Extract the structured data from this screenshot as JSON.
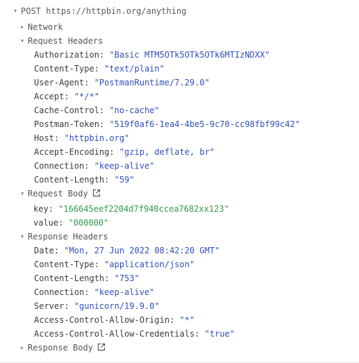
{
  "request": {
    "method": "POST",
    "url": "https://httpbin.org/anything"
  },
  "sections": {
    "network": "Network",
    "request_headers": "Request Headers",
    "request_body": "Request Body",
    "response_headers": "Response Headers",
    "response_body": "Response Body"
  },
  "request_headers": [
    {
      "key": "Authorization",
      "value": "\"Basic MTM5OTk5OTk5OTk6MTIzNDXX\""
    },
    {
      "key": "Content-Type",
      "value": "\"text/plain\""
    },
    {
      "key": "User-Agent",
      "value": "\"PostmanRuntime/7.29.0\""
    },
    {
      "key": "Accept",
      "value": "\"*/*\""
    },
    {
      "key": "Cache-Control",
      "value": "\"no-cache\""
    },
    {
      "key": "Postman-Token",
      "value": "\"519f0af6-1ea4-4be5-9c70-cc98fbf99c42\""
    },
    {
      "key": "Host",
      "value": "\"httpbin.org\""
    },
    {
      "key": "Accept-Encoding",
      "value": "\"gzip, deflate, br\""
    },
    {
      "key": "Connection",
      "value": "\"keep-alive\""
    },
    {
      "key": "Content-Length",
      "value": "\"59\""
    }
  ],
  "request_body": [
    {
      "key": "key",
      "value": "\"166645eef2204d7f940ccea7682xx123\""
    },
    {
      "key": "value",
      "value": "\"000000\""
    }
  ],
  "response_headers": [
    {
      "key": "Date",
      "value": "\"Mon, 27 Jun 2022 08:42:20 GMT\""
    },
    {
      "key": "Content-Type",
      "value": "\"application/json\""
    },
    {
      "key": "Content-Length",
      "value": "\"753\""
    },
    {
      "key": "Connection",
      "value": "\"keep-alive\""
    },
    {
      "key": "Server",
      "value": "\"gunicorn/19.9.0\""
    },
    {
      "key": "Access-Control-Allow-Origin",
      "value": "\"*\""
    },
    {
      "key": "Access-Control-Allow-Credentials",
      "value": "\"true\""
    }
  ],
  "colors": {
    "header_value": "#2f4fb5",
    "body_value": "#2f9a4c"
  },
  "icons": {
    "expanded": "triangle-down-icon",
    "collapsed": "triangle-right-icon",
    "open_external": "external-link-icon"
  }
}
